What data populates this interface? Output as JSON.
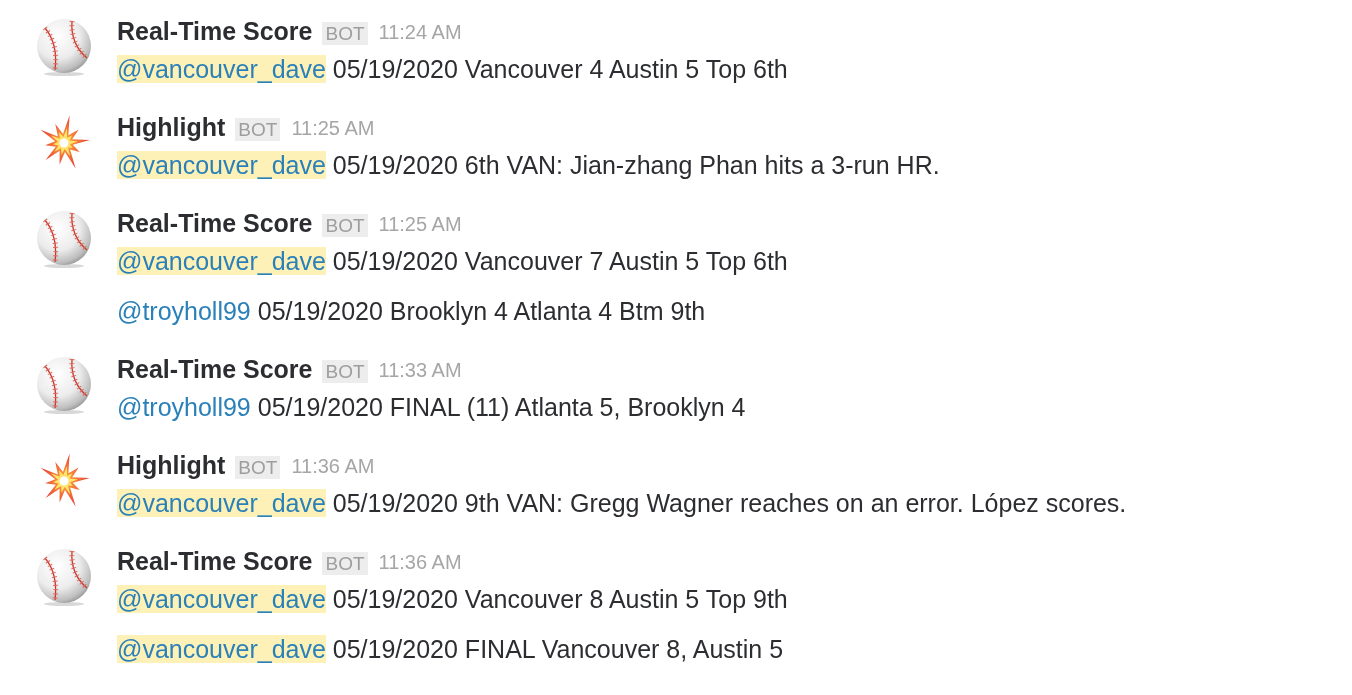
{
  "messages": [
    {
      "kind": "baseball",
      "sender": "Real-Time Score",
      "badge": "BOT",
      "time": "11:24 AM",
      "lines": [
        {
          "mention": "@vancouver_dave",
          "highlighted": true,
          "text": "05/19/2020 Vancouver 4 Austin 5 Top 6th"
        }
      ]
    },
    {
      "kind": "collision",
      "sender": "Highlight",
      "badge": "BOT",
      "time": "11:25 AM",
      "lines": [
        {
          "mention": "@vancouver_dave",
          "highlighted": true,
          "text": "05/19/2020 6th VAN: Jian-zhang Phan hits a 3-run HR."
        }
      ]
    },
    {
      "kind": "baseball",
      "sender": "Real-Time Score",
      "badge": "BOT",
      "time": "11:25 AM",
      "lines": [
        {
          "mention": "@vancouver_dave",
          "highlighted": true,
          "text": "05/19/2020 Vancouver 7 Austin 5 Top 6th"
        },
        {
          "mention": "@troyholl99",
          "highlighted": false,
          "text": "05/19/2020 Brooklyn 4 Atlanta 4 Btm 9th"
        }
      ]
    },
    {
      "kind": "baseball",
      "sender": "Real-Time Score",
      "badge": "BOT",
      "time": "11:33 AM",
      "lines": [
        {
          "mention": "@troyholl99",
          "highlighted": false,
          "text": "05/19/2020 FINAL (11) Atlanta 5, Brooklyn 4"
        }
      ]
    },
    {
      "kind": "collision",
      "sender": "Highlight",
      "badge": "BOT",
      "time": "11:36 AM",
      "lines": [
        {
          "mention": "@vancouver_dave",
          "highlighted": true,
          "text": "05/19/2020 9th VAN: Gregg Wagner reaches on an error. López scores."
        }
      ]
    },
    {
      "kind": "baseball",
      "sender": "Real-Time Score",
      "badge": "BOT",
      "time": "11:36 AM",
      "lines": [
        {
          "mention": "@vancouver_dave",
          "highlighted": true,
          "text": "05/19/2020 Vancouver 8 Austin 5 Top 9th"
        },
        {
          "mention": "@vancouver_dave",
          "highlighted": true,
          "text": "05/19/2020 FINAL Vancouver 8, Austin 5"
        }
      ]
    }
  ]
}
